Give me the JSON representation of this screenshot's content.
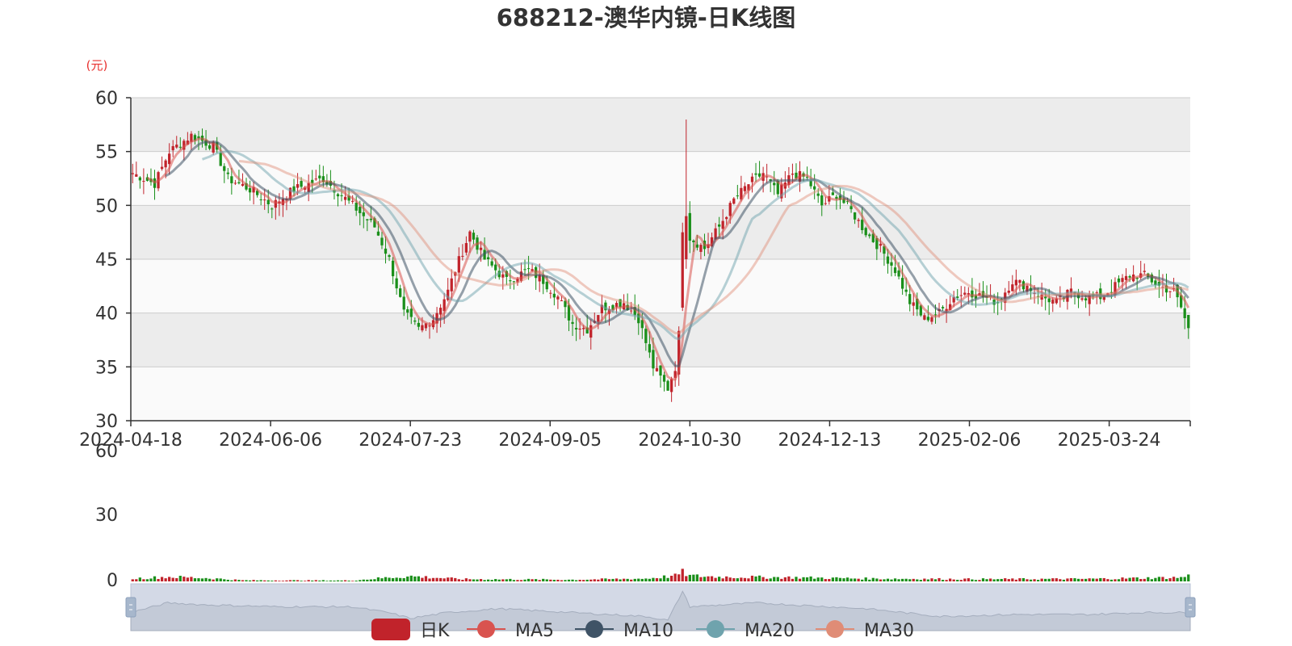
{
  "chart_data": {
    "type": "candlestick",
    "title": "688212-澳华内镜-日K线图",
    "unit_label": "(元)",
    "price_axis": {
      "min": 30,
      "max": 60,
      "ticks": [
        "30",
        "35",
        "40",
        "45",
        "50",
        "55",
        "60"
      ]
    },
    "volume_axis": {
      "ticks": [
        "0",
        "30",
        "60"
      ]
    },
    "x_tick_labels": [
      "2024-04-18",
      "2024-06-06",
      "2024-07-23",
      "2024-09-05",
      "2024-10-30",
      "2024-12-13",
      "2025-02-06",
      "2025-03-24"
    ],
    "trading_days": 240,
    "up_color": "#c1232b",
    "down_color": "#1a8f1a",
    "legend": [
      {
        "name": "日K",
        "color": "#c1232b",
        "shape": "rect"
      },
      {
        "name": "MA5",
        "color": "#d9534f",
        "shape": "line-circle"
      },
      {
        "name": "MA10",
        "color": "#3f5366",
        "shape": "line-circle"
      },
      {
        "name": "MA20",
        "color": "#6fa3ad",
        "shape": "line-circle"
      },
      {
        "name": "MA30",
        "color": "#e08c76",
        "shape": "line-circle"
      }
    ],
    "close_anchors": [
      [
        0,
        53
      ],
      [
        6,
        52
      ],
      [
        10,
        55
      ],
      [
        16,
        56.5
      ],
      [
        22,
        55.5
      ],
      [
        26,
        52.5
      ],
      [
        32,
        51.5
      ],
      [
        38,
        50
      ],
      [
        44,
        51.5
      ],
      [
        52,
        52.5
      ],
      [
        60,
        50
      ],
      [
        66,
        48
      ],
      [
        70,
        45
      ],
      [
        74,
        40
      ],
      [
        78,
        38.5
      ],
      [
        82,
        39.5
      ],
      [
        86,
        42
      ],
      [
        88,
        44
      ],
      [
        92,
        47.5
      ],
      [
        96,
        45
      ],
      [
        102,
        43
      ],
      [
        108,
        44
      ],
      [
        112,
        43
      ],
      [
        116,
        41.5
      ],
      [
        120,
        39
      ],
      [
        124,
        38.5
      ],
      [
        128,
        40.5
      ],
      [
        134,
        41
      ],
      [
        138,
        39.5
      ],
      [
        142,
        35
      ],
      [
        146,
        33
      ],
      [
        148,
        35
      ],
      [
        149,
        38
      ],
      [
        150,
        44
      ],
      [
        151,
        50
      ],
      [
        152,
        47
      ],
      [
        156,
        46
      ],
      [
        160,
        48
      ],
      [
        164,
        50.5
      ],
      [
        168,
        52
      ],
      [
        172,
        53
      ],
      [
        176,
        51
      ],
      [
        180,
        53
      ],
      [
        184,
        52.5
      ],
      [
        188,
        50
      ],
      [
        192,
        51
      ],
      [
        196,
        49.5
      ],
      [
        200,
        47.5
      ],
      [
        204,
        46
      ],
      [
        208,
        44
      ],
      [
        212,
        41
      ],
      [
        216,
        39.5
      ],
      [
        220,
        40
      ],
      [
        224,
        41.5
      ],
      [
        228,
        42
      ],
      [
        232,
        41.5
      ],
      [
        236,
        41
      ],
      [
        240,
        43
      ],
      [
        244,
        42.5
      ],
      [
        248,
        41.5
      ],
      [
        252,
        41
      ],
      [
        256,
        42
      ],
      [
        260,
        41.5
      ],
      [
        264,
        41.5
      ],
      [
        268,
        42.5
      ],
      [
        272,
        43.5
      ],
      [
        276,
        43.5
      ],
      [
        280,
        42.5
      ],
      [
        284,
        42
      ],
      [
        286,
        40.5
      ],
      [
        288,
        38.5
      ]
    ],
    "volume_anchors": [
      [
        0,
        2.5
      ],
      [
        10,
        4
      ],
      [
        20,
        3
      ],
      [
        30,
        1
      ],
      [
        60,
        0.8
      ],
      [
        70,
        3.5
      ],
      [
        76,
        4.5
      ],
      [
        90,
        2
      ],
      [
        120,
        1.5
      ],
      [
        140,
        2.5
      ],
      [
        148,
        5
      ],
      [
        150,
        8
      ],
      [
        152,
        5
      ],
      [
        160,
        4
      ],
      [
        180,
        3.5
      ],
      [
        200,
        2.5
      ],
      [
        230,
        2
      ],
      [
        260,
        2.2
      ],
      [
        286,
        3.5
      ],
      [
        288,
        5
      ]
    ],
    "overview_anchors": [
      [
        0,
        0.3
      ],
      [
        10,
        0.55
      ],
      [
        20,
        0.5
      ],
      [
        40,
        0.45
      ],
      [
        60,
        0.45
      ],
      [
        70,
        0.3
      ],
      [
        76,
        0.15
      ],
      [
        86,
        0.3
      ],
      [
        100,
        0.4
      ],
      [
        120,
        0.3
      ],
      [
        140,
        0.2
      ],
      [
        146,
        0.1
      ],
      [
        150,
        0.85
      ],
      [
        152,
        0.45
      ],
      [
        170,
        0.55
      ],
      [
        180,
        0.5
      ],
      [
        200,
        0.4
      ],
      [
        210,
        0.3
      ],
      [
        220,
        0.2
      ],
      [
        240,
        0.25
      ],
      [
        260,
        0.25
      ],
      [
        275,
        0.3
      ],
      [
        288,
        0.3
      ]
    ]
  }
}
